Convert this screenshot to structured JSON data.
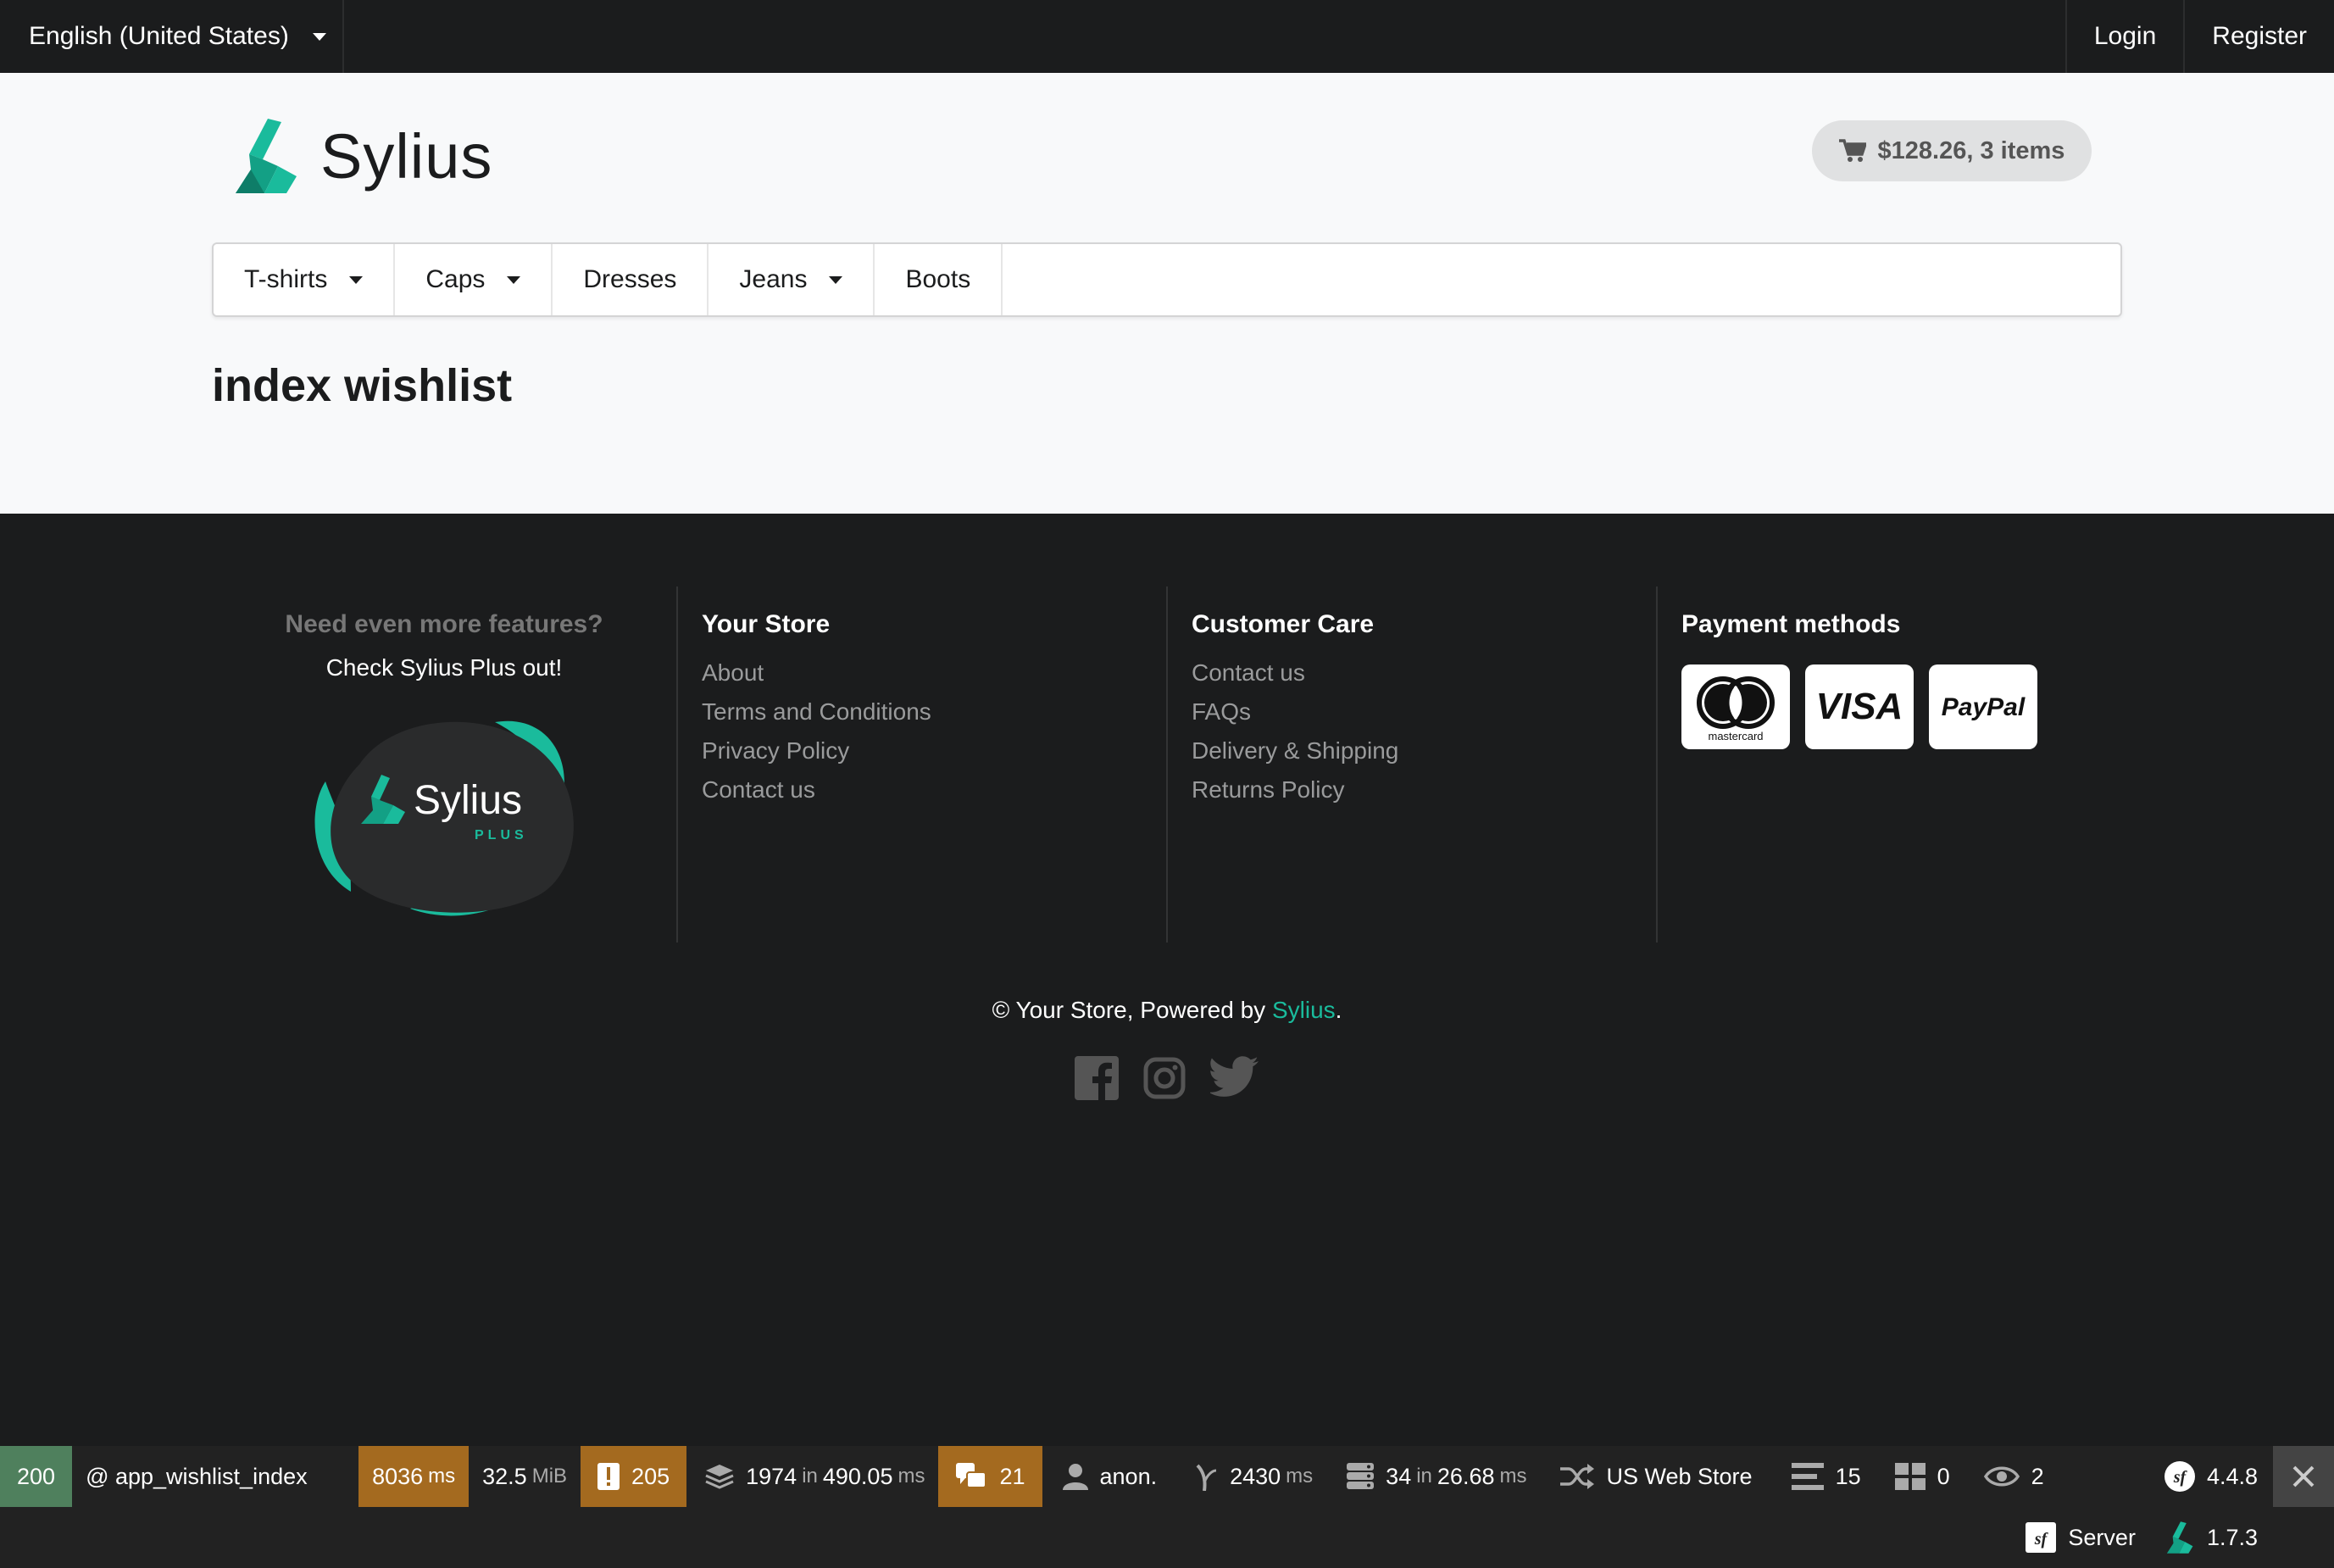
{
  "topbar": {
    "language": "English (United States)",
    "login": "Login",
    "register": "Register"
  },
  "header": {
    "logo_text": "Sylius",
    "cart_summary": "$128.26, 3 items"
  },
  "menu": [
    {
      "label": "T-shirts",
      "dropdown": true
    },
    {
      "label": "Caps",
      "dropdown": true
    },
    {
      "label": "Dresses",
      "dropdown": false
    },
    {
      "label": "Jeans",
      "dropdown": true
    },
    {
      "label": "Boots",
      "dropdown": false
    }
  ],
  "page": {
    "title": "index wishlist"
  },
  "footer": {
    "plus": {
      "title": "Need even more features?",
      "subtitle": "Check Sylius Plus out!",
      "badge_name": "Sylius",
      "badge_tag": "PLUS"
    },
    "your_store": {
      "heading": "Your Store",
      "links": [
        "About",
        "Terms and Conditions",
        "Privacy Policy",
        "Contact us"
      ]
    },
    "customer_care": {
      "heading": "Customer Care",
      "links": [
        "Contact us",
        "FAQs",
        "Delivery & Shipping",
        "Returns Policy"
      ]
    },
    "payment": {
      "heading": "Payment methods",
      "logos": [
        "mastercard",
        "VISA",
        "PayPal"
      ]
    },
    "copyright_prefix": "© Your Store, Powered by ",
    "copyright_brand": "Sylius",
    "copyright_suffix": ".",
    "social_icons": [
      "facebook-icon",
      "instagram-icon",
      "twitter-icon"
    ]
  },
  "debug_toolbar": {
    "status": "200",
    "route": "@ app_wishlist_index",
    "time": "8036",
    "time_unit": "ms",
    "memory": "32.5",
    "memory_unit": "MiB",
    "logs": "205",
    "cache_calls": "1974",
    "cache_in": "in",
    "cache_time": "490.05",
    "cache_unit": "ms",
    "translations": "21",
    "user": "anon.",
    "events_time": "2430",
    "events_unit": "ms",
    "db_queries": "34",
    "db_in": "in",
    "db_time": "26.68",
    "db_unit": "ms",
    "channel": "US Web Store",
    "forms": "15",
    "blocks": "0",
    "views": "2",
    "symfony_version": "4.4.8",
    "server": "Server",
    "sylius_version": "1.7.3"
  },
  "colors": {
    "accent": "#1abb9c",
    "status_ok": "#4f805d",
    "warning": "#a46a1f",
    "dark": "#1b1c1d"
  }
}
